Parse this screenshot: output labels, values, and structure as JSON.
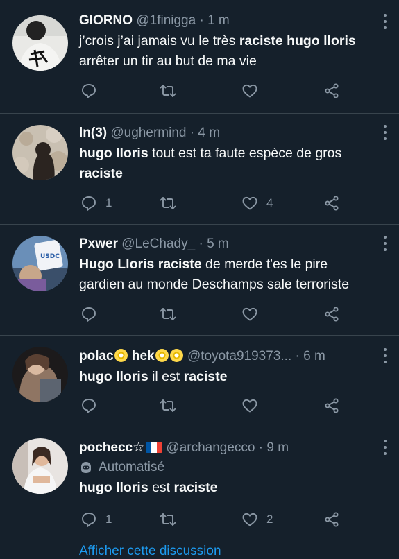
{
  "colors": {
    "background": "#15202b",
    "divider": "#38444d",
    "muted": "#8b98a5",
    "text": "#f7f9f9",
    "link": "#1d9bf0"
  },
  "tweets": [
    {
      "name": "GIORNO",
      "handle": "@1finigga",
      "time": "1 m",
      "text": [
        {
          "t": "j’crois j’ai jamais vu le très ",
          "b": false
        },
        {
          "t": "raciste hugo lloris",
          "b": true
        },
        {
          "t": " arrêter un tir au but de ma vie",
          "b": false
        }
      ],
      "reply_count": "",
      "like_count": ""
    },
    {
      "name": "ln(3)",
      "handle": "@ughermind",
      "time": "4 m",
      "text": [
        {
          "t": "hugo lloris",
          "b": true
        },
        {
          "t": " tout est ta faute espèce de gros ",
          "b": false
        },
        {
          "t": "raciste",
          "b": true
        }
      ],
      "reply_count": "1",
      "like_count": "4"
    },
    {
      "name": "Pxwer",
      "handle": "@LeChady_",
      "time": "5 m",
      "text": [
        {
          "t": "Hugo Lloris raciste",
          "b": true
        },
        {
          "t": " de merde t'es le pire gardien au monde Deschamps sale terroriste",
          "b": false
        }
      ],
      "reply_count": "",
      "like_count": ""
    },
    {
      "name_part1": "polac",
      "name_part2": "hek",
      "handle": "@toyota919373...",
      "time": "6 m",
      "text": [
        {
          "t": "hugo lloris",
          "b": true
        },
        {
          "t": " il est ",
          "b": false
        },
        {
          "t": "raciste",
          "b": true
        }
      ],
      "reply_count": "",
      "like_count": ""
    },
    {
      "name": "pochecc☆",
      "handle": "@archangecco",
      "time": "9 m",
      "automated_label": "Automatisé",
      "text": [
        {
          "t": "hugo lloris",
          "b": true
        },
        {
          "t": " est ",
          "b": false
        },
        {
          "t": "raciste",
          "b": true
        }
      ],
      "reply_count": "1",
      "like_count": "2"
    }
  ],
  "icons": {
    "reply": "reply-icon",
    "retweet": "retweet-icon",
    "like": "like-icon",
    "share": "share-icon",
    "more": "more-icon",
    "bot": "bot-icon"
  },
  "footer_link": "Afficher cette discussion"
}
